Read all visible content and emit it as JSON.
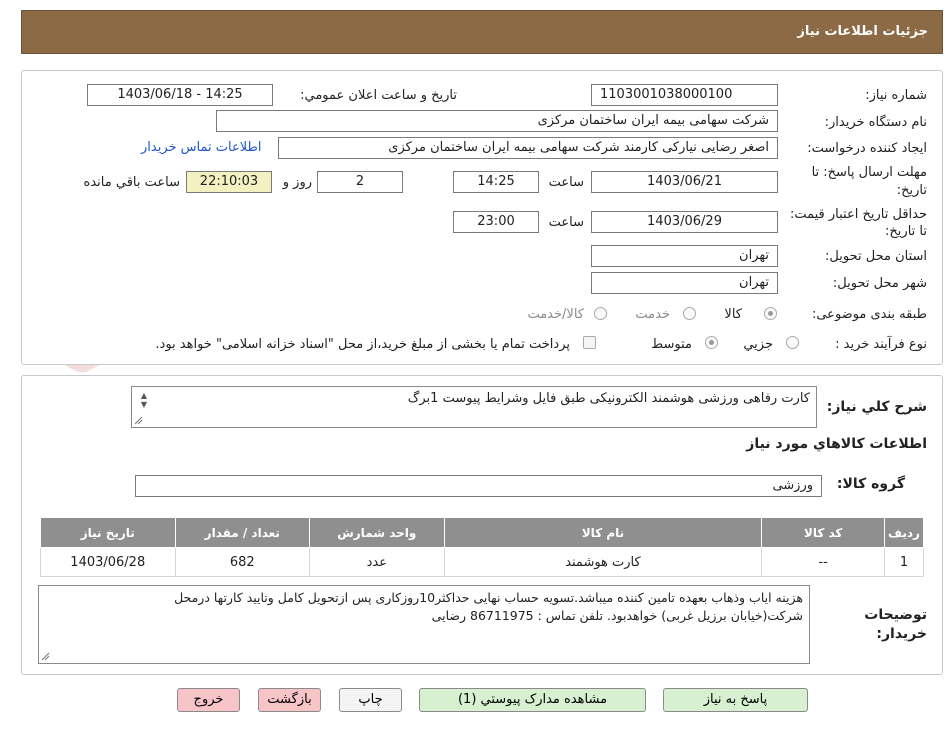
{
  "header": {
    "title": "جزئیات اطلاعات نیاز"
  },
  "fields": {
    "need_number": {
      "label": "شماره نیاز:",
      "value": "1103001038000100"
    },
    "announce_datetime": {
      "label": "تاریخ و ساعت اعلان عمومي:",
      "value": "1403/06/18 - 14:25"
    },
    "buyer_org": {
      "label": "نام دستگاه خریدار:",
      "value": "شرکت سهامی بیمه ایران ساختمان مرکزی"
    },
    "requester": {
      "label": "ایجاد کننده درخواست:",
      "value": "اصغر رضایی نیارکی کارمند شرکت سهامی بیمه ایران ساختمان مرکزی",
      "link": "اطلاعات تماس خریدار"
    },
    "reply_deadline": {
      "label": "مهلت ارسال پاسخ: تا تاریخ:",
      "date": "1403/06/21",
      "time_label": "ساعت",
      "time": "14:25",
      "days": "2",
      "days_label": "روز و",
      "remaining": "22:10:03",
      "remaining_label": "ساعت باقي مانده"
    },
    "price_validity": {
      "label": "حداقل تاریخ اعتبار قیمت: تا تاریخ:",
      "date": "1403/06/29",
      "time_label": "ساعت",
      "time": "23:00"
    },
    "province": {
      "label": "استان محل تحویل:",
      "value": "تهران"
    },
    "city": {
      "label": "شهر محل تحویل:",
      "value": "تهران"
    },
    "category": {
      "label": "طبقه بندی موضوعی:",
      "options": [
        "کالا",
        "خدمت",
        "کالا/خدمت"
      ],
      "selected": "کالا"
    },
    "process_type": {
      "label": "نوع فرآیند خرید :",
      "options": [
        "جزیي",
        "متوسط"
      ],
      "selected": "متوسط",
      "payment_note": "پرداخت تمام یا بخشی از مبلغ خرید،از محل \"اسناد خزانه اسلامی\" خواهد بود."
    }
  },
  "description": {
    "label": "شرح کلي نیاز:",
    "value": "کارت رفاهی ورزشی هوشمند الکترونیکی طبق فایل وشرایط پیوست  1برگ"
  },
  "goods": {
    "section_title": "اطلاعات کالاهاي مورد نیاز",
    "group_label": "گروه کالا:",
    "group_value": "ورزشی",
    "columns": [
      "ردیف",
      "کد کالا",
      "نام کالا",
      "واحد شمارش",
      "تعداد / مقدار",
      "تاریخ نیاز"
    ],
    "rows": [
      {
        "row": "1",
        "code": "--",
        "name": "کارت هوشمند",
        "unit": "عدد",
        "qty": "682",
        "date": "1403/06/28"
      }
    ]
  },
  "buyer_notes": {
    "label": "توضیحات خریدار:",
    "line1": "هزینه ایاب وذهاب  بعهده تامین کننده میباشد.تسویه حساب نهایی حداکثر10روزکاری پس ازتحویل کامل وتایید کارتها درمحل",
    "line2": "شرکت(خیابان برزیل غربی) خواهدبود. تلفن تماس :        86711975    رضایی"
  },
  "buttons": {
    "reply": "پاسخ به نیاز",
    "attachments": "مشاهده مدارک پیوستي (1)",
    "print": "چاپ",
    "back": "بازگشت",
    "exit": "خروج"
  },
  "watermark": "AriaTender.neT",
  "colors": {
    "header": "#8c6a45",
    "table_header": "#8f8f8f",
    "link": "#1f57c7",
    "green_button": "#d6f0d0",
    "pink_button": "#f7c4c8",
    "remaining_time": "#f3f0c2"
  }
}
